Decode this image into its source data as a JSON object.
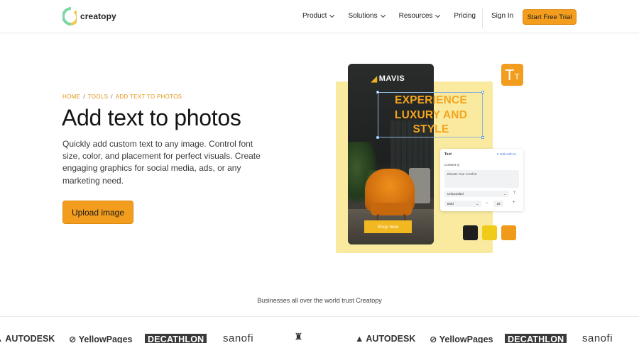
{
  "header": {
    "logo_text": "creatopy",
    "nav": [
      {
        "label": "Product",
        "has_dropdown": true
      },
      {
        "label": "Solutions",
        "has_dropdown": true
      },
      {
        "label": "Resources",
        "has_dropdown": true
      },
      {
        "label": "Pricing",
        "has_dropdown": false
      }
    ],
    "sign_in": "Sign In",
    "cta": "Start Free Trial"
  },
  "breadcrumb": [
    "HOME",
    "TOOLS",
    "ADD TEXT TO PHOTOS"
  ],
  "hero": {
    "title": "Add text to photos",
    "description": "Quickly add custom text to any image. Control font size, color, and placement for perfect visuals. Create engaging graphics for social media, ads, or any marketing need.",
    "button": "Upload image"
  },
  "illustration": {
    "brand": "MAVIS",
    "headline": "EXPERIENCE LUXURY AND STYLE",
    "shop_button": "Shop here",
    "text_icon": "text-size-icon",
    "editor": {
      "title": "Text",
      "ai_label": "Edit with AI",
      "content_label": "Content",
      "content_value": "Elevate Your Comfort",
      "font_select": "Unbounded",
      "weight_select": "Bold",
      "size_value": "28"
    },
    "swatches": [
      "#1e1e1e",
      "#f1cb1a",
      "#f09a1a"
    ]
  },
  "trust": {
    "text": "Businesses all over the world trust Creatopy",
    "logos": [
      "AUTODESK",
      "YellowPages",
      "DECATHLON",
      "sanofi",
      "",
      "AUTODESK",
      "YellowPages",
      "DECATHLON",
      "sanofi"
    ]
  },
  "colors": {
    "accent": "#f29d1d",
    "headline": "#f4a51e",
    "panel": "#faeaa0"
  }
}
